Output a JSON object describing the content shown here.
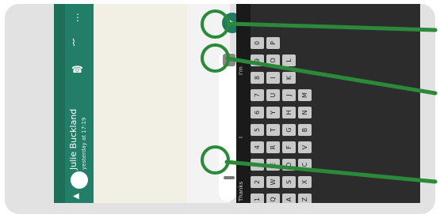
{
  "chat": {
    "contact_name": "Julie Buckland",
    "contact_status": "yesterday at 17:19"
  },
  "keyboard": {
    "rows": [
      [
        "1",
        "2",
        "3",
        "4",
        "5",
        "6",
        "7",
        "8",
        "9",
        "0"
      ],
      [
        "Q",
        "W",
        "E",
        "R",
        "T",
        "Y",
        "U",
        "I",
        "O",
        "P"
      ],
      [
        "A",
        "S",
        "D",
        "F",
        "G",
        "H",
        "J",
        "K",
        "L"
      ],
      [
        "Z",
        "X",
        "C",
        "V",
        "B",
        "N",
        "M"
      ]
    ],
    "suggestions": [
      "Thanks",
      "I",
      "I'm"
    ]
  },
  "callouts": [
    {
      "target": "send-button"
    },
    {
      "target": "emoji-button"
    },
    {
      "target": "attach-button"
    }
  ],
  "colors": {
    "header_green": "#237e67",
    "callout_green": "#2a8a3a",
    "keyboard_bg": "#2c2c2c"
  }
}
